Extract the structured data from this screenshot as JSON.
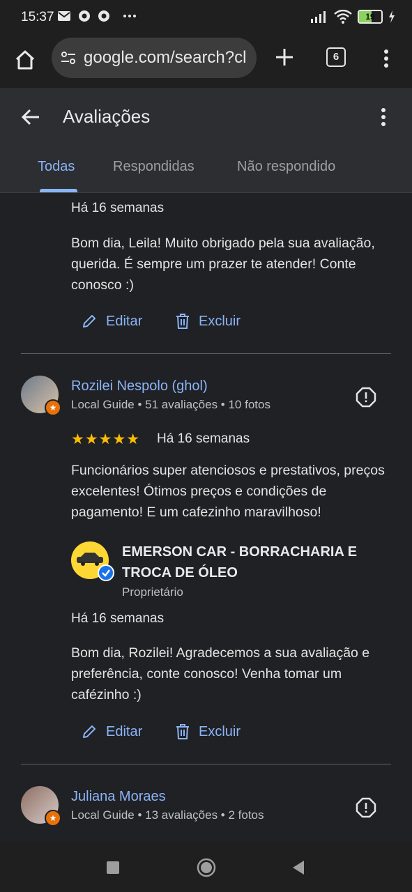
{
  "status_bar": {
    "time": "15:37",
    "battery": "19",
    "icons": [
      "mail-icon",
      "chrome-icon",
      "chrome-icon",
      "more-icon",
      "signal-icon",
      "wifi-icon",
      "battery-icon",
      "charging-icon"
    ]
  },
  "browser": {
    "url": "google.com/search?cl",
    "tab_count": "6"
  },
  "page": {
    "title": "Avaliações",
    "tabs": [
      {
        "label": "Todas",
        "active": true
      },
      {
        "label": "Respondidas",
        "active": false
      },
      {
        "label": "Não respondido",
        "active": false
      }
    ]
  },
  "reviews": [
    {
      "reply": {
        "time": "Há 16 semanas",
        "text": "Bom dia, Leila! Muito obrigado pela sua avaliação, querida. É sempre um prazer te atender! Conte conosco :)",
        "edit_label": "Editar",
        "delete_label": "Excluir"
      }
    },
    {
      "author": "Rozilei Nespolo (ghol)",
      "meta": "Local Guide • 51 avaliações • 10 fotos",
      "rating": "★★★★★",
      "rating_value": 5,
      "time": "Há 16 semanas",
      "text": "Funcionários super atenciosos e prestativos, preços excelentes! Ótimos preços e condições de pagamento! E um cafezinho maravilhoso!",
      "owner": {
        "name": "EMERSON CAR - BORRACHARIA E TROCA DE ÓLEO",
        "role": "Proprietário"
      },
      "reply": {
        "time": "Há 16 semanas",
        "text": "Bom dia, Rozilei! Agradecemos a sua avaliação e preferência, conte conosco! Venha tomar um cafézinho :)",
        "edit_label": "Editar",
        "delete_label": "Excluir"
      }
    },
    {
      "author": "Juliana Moraes",
      "meta": "Local Guide • 13 avaliações • 2 fotos"
    }
  ],
  "colors": {
    "background": "#202124",
    "accent": "#8ab4f8",
    "star": "#fbbc04",
    "badge": "#e8710a"
  }
}
